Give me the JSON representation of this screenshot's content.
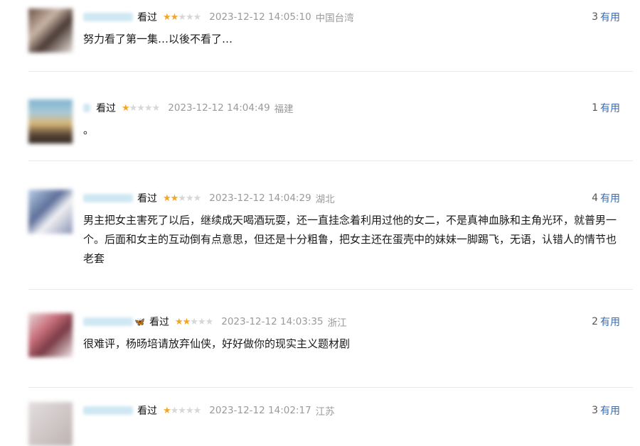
{
  "comments": [
    {
      "watched": "看过",
      "stars": {
        "on": "★★",
        "off": "★★★"
      },
      "time": "2023-12-12 14:05:10",
      "location": "中国台湾",
      "useful_count": "3",
      "useful_label": "有用",
      "text": "努力看了第一集…以後不看了…"
    },
    {
      "watched": "看过",
      "stars": {
        "on": "★",
        "off": "★★★★"
      },
      "time": "2023-12-12 14:04:49",
      "location": "福建",
      "useful_count": "1",
      "useful_label": "有用",
      "text": "。"
    },
    {
      "watched": "看过",
      "stars": {
        "on": "★★",
        "off": "★★★"
      },
      "time": "2023-12-12 14:04:29",
      "location": "湖北",
      "useful_count": "4",
      "useful_label": "有用",
      "text": "男主把女主害死了以后，继续成天喝酒玩耍，还一直挂念着利用过他的女二，不是真神血脉和主角光环，就普男一个。后面和女主的互动倒有点意思，但还是十分粗鲁，把女主还在蛋壳中的妹妹一脚踢飞，无语，认错人的情节也老套"
    },
    {
      "watched": "看过",
      "butterfly": "🦋",
      "stars": {
        "on": "★★",
        "off": "★★★"
      },
      "time": "2023-12-12 14:03:35",
      "location": "浙江",
      "useful_count": "2",
      "useful_label": "有用",
      "text": "很难评，杨旸培请放弃仙侠，好好做你的现实主义题材剧"
    },
    {
      "watched": "看过",
      "stars": {
        "on": "★",
        "off": "★★★★"
      },
      "time": "2023-12-12 14:02:17",
      "location": "江苏",
      "useful_count": "3",
      "useful_label": "有用"
    }
  ]
}
